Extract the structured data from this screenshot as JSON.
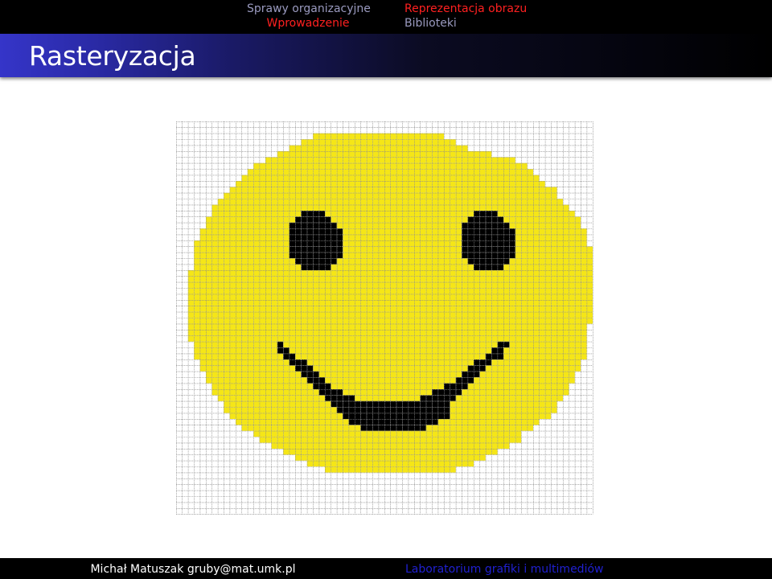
{
  "header": {
    "nav_groups": [
      {
        "items": [
          {
            "label": "Sprawy organizacyjne",
            "active": false
          },
          {
            "label": "Wprowadzenie",
            "active": true
          }
        ]
      },
      {
        "items": [
          {
            "label": "Reprezentacja obrazu",
            "active": true
          },
          {
            "label": "Biblioteki",
            "active": false
          }
        ]
      }
    ],
    "frame_title": "Rasteryzacja"
  },
  "footer": {
    "author": "Michał Matuszak",
    "email": "gruby@mat.umk.pl",
    "course": "Laboratorium grafiki i multimediów"
  },
  "colors": {
    "face": "#f5e617",
    "feature": "#000000",
    "grid_line": "#8a8a8a",
    "empty_cell": "#ffffff",
    "nav_active": "#ff2020",
    "nav_inactive": "#9a9abf",
    "course_text": "#2020d0"
  },
  "figure": {
    "grid": {
      "columns": 70,
      "rows": 66
    },
    "legend": {
      ".": "empty",
      "Y": "yellow",
      "B": "black"
    },
    "pixel_rows": [
      "......................................................................",
      "......................................................................",
      ".......................YYYYYYYYYYYYYYYYYYYYYY.........................",
      ".....................YYYYYYYYYYYYYYYYYYYYYYYYYY.......................",
      "...................YYYYYYYYYYYYYYYYYYYYYYYYYYYYYY.....................",
      ".................YYYYYYYYYYYYYYYYYYYYYYYYYYYYYYYYYYYY.................",
      "...............YYYYYYYYYYYYYYYYYYYYYYYYYYYYYYYYYYYYYYYYYY.............",
      ".............YYYYYYYYYYYYYYYYYYYYYYYYYYYYYYYYYYYYYYYYYYYYYY...........",
      "............YYYYYYYYYYYYYYYYYYYYYYYYYYYYYYYYYYYYYYYYYYYYYYYY..........",
      "...........YYYYYYYYYYYYYYYYYYYYYYYYYYYYYYYYYYYYYYYYYYYYYYYYYY.........",
      "..........YYYYYYYYYYYYYYYYYYYYYYYYYYYYYYYYYYYYYYYYYYYYYYYYYYYY........",
      ".........YYYYYYYYYYYYYYYYYYYYYYYYYYYYYYYYYYYYYYYYYYYYYYYYYYYYYYY......",
      "........YYYYYYYYYYYYYYYYYYYYYYYYYYYYYYYYYYYYYYYYYYYYYYYYYYYYYYYY......",
      ".......YYYYYYYYYYYYYYYYYYYYYYYYYYYYYYYYYYYYYYYYYYYYYYYYYYYYYYYYYY.....",
      "......YYYYYYYYYYYYYYYYYYYYYYYYYYYYYYYYYYYYYYYYYYYYYYYYYYYYYYYYYYYY....",
      "......YYYYYYYYYYYYYYYBBBBYYYYYYYYYYYYYYYYYYYYYYYYYBBBBYYYYYYYYYYYYY....",
      ".....YYYYYYYYYYYYYYYBBBBBBYYYYYYYYYYYYYYYYYYYYYYYBBBBBBYYYYYYYYYYYYY...",
      ".....YYYYYYYYYYYYYYBBBBBBBBYYYYYYYYYYYYYYYYYYYYYBBBBBBBBYYYYYYYYYYYY...",
      "....YYYYYYYYYYYYYYYBBBBBBBBBYYYYYYYYYYYYYYYYYYYYBBBBBBBBBYYYYYYYYYYYY..",
      "....YYYYYYYYYYYYYYYBBBBBBBBBYYYYYYYYYYYYYYYYYYYYBBBBBBBBBYYYYYYYYYYYY..",
      "...YYYYYYYYYYYYYYYYBBBBBBBBBYYYYYYYYYYYYYYYYYYYYBBBBBBBBBYYYYYYYYYYYY..",
      "...YYYYYYYYYYYYYYYYBBBBBBBBBYYYYYYYYYYYYYYYYYYYYBBBBBBBBBYYYYYYYYYYYYY.",
      "...YYYYYYYYYYYYYYYYBBBBBBBBBYYYYYYYYYYYYYYYYYYYYBBBBBBBBBYYYYYYYYYYYYY.",
      "...YYYYYYYYYYYYYYYYYBBBBBBBYYYYYYYYYYYYYYYYYYYYYYBBBBBBBYYYYYYYYYYYYYY.",
      "...YYYYYYYYYYYYYYYYYYBBBBBYYYYYYYYYYYYYYYYYYYYYYYYBBBBBYYYYYYYYYYYYYYY.",
      "..YYYYYYYYYYYYYYYYYYYYYYYYYYYYYYYYYYYYYYYYYYYYYYYYYYYYYYYYYYYYYYYYYYYY",
      "..YYYYYYYYYYYYYYYYYYYYYYYYYYYYYYYYYYYYYYYYYYYYYYYYYYYYYYYYYYYYYYYYYYYY",
      "..YYYYYYYYYYYYYYYYYYYYYYYYYYYYYYYYYYYYYYYYYYYYYYYYYYYYYYYYYYYYYYYYYYYY",
      "..YYYYYYYYYYYYYYYYYYYYYYYYYYYYYYYYYYYYYYYYYYYYYYYYYYYYYYYYYYYYYYYYYYYY",
      "..YYYYYYYYYYYYYYYYYYYYYYYYYYYYYYYYYYYYYYYYYYYYYYYYYYYYYYYYYYYYYYYYYYYY",
      "..YYYYYYYYYYYYYYYYYYYYYYYYYYYYYYYYYYYYYYYYYYYYYYYYYYYYYYYYYYYYYYYYYYYY",
      "..YYYYYYYYYYYYYYYYYYYYYYYYYYYYYYYYYYYYYYYYYYYYYYYYYYYYYYYYYYYYYYYYYYYY",
      "..YYYYYYYYYYYYYYYYYYYYYYYYYYYYYYYYYYYYYYYYYYYYYYYYYYYYYYYYYYYYYYYYYYYY",
      "..YYYYYYYYYYYYYYYYYYYYYYYYYYYYYYYYYYYYYYYYYYYYYYYYYYYYYYYYYYYYYYYYYYYY",
      "..YYYYYYYYYYYYYYYYYYYYYYYYYYYYYYYYYYYYYYYYYYYYYYYYYYYYYYYYYYYYYYYYYYY.",
      "..YYYYYYYYYYYYYYYYYYYYYYYYYYYYYYYYYYYYYYYYYYYYYYYYYYYYYYYYYYYYYYYYYYY.",
      "..YYYYYYYYYYYYYYYYYYYYYYYYYYYYYYYYYYYYYYYYYYYYYYYYYYYYYYYYYYYYYYYYYYY.",
      "...YYYYYYYYYYYYYYBYYYYYYYYYYYYYYYYYYYYYYYYYYYYYYYYYYYYBBYYYYYYYYYYYYY.",
      "...YYYYYYYYYYYYYYBBYYYYYYYYYYYYYYYYYYYYYYYYYYYYYYYYYYBBYYYYYYYYYYYYYY.",
      "...YYYYYYYYYYYYYYYBBYYYYYYYYYYYYYYYYYYYYYYYYYYYYYYYYBBBYYYYYYYYYYYYYY.",
      "....YYYYYYYYYYYYYYYBBBYYYYYYYYYYYYYYYYYYYYYYYYYYYYBBBYYYYYYYYYYYYYYY..",
      "....YYYYYYYYYYYYYYYYBBBYYYYYYYYYYYYYYYYYYYYYYYYYYBBBYYYYYYYYYYYYYYYY..",
      ".....YYYYYYYYYYYYYYYYBBBYYYYYYYYYYYYYYYYYYYYYYYYBBBYYYYYYYYYYYYYYYY...",
      ".....YYYYYYYYYYYYYYYYYBBBYYYYYYYYYYYYYYYYYYYYYYBBBYYYYYYYYYYYYYYYYY...",
      "......YYYYYYYYYYYYYYYYYBBBYYYYYYYYYYYYYYYYYYYBBBBYYYYYYYYYYYYYYYYY....",
      "......YYYYYYYYYYYYYYYYYYBBBBYYYYYYYYYYYYYYYBBBBBYYYYYYYYYYYYYYYYYY....",
      ".......YYYYYYYYYYYYYYYYYYBBBBBYYYYYYYYYYYBBBBBBYYYYYYYYYYYYYYYYYY.....",
      "........YYYYYYYYYYYYYYYYYYBBBBBBBBBBBBBBBBBBBBYYYYYYYYYYYYYYYYYY......",
      "........YYYYYYYYYYYYYYYYYYYBBBBBBBBBBBBBBBBBBBYYYYYYYYYYYYYYYYYY......",
      ".........YYYYYYYYYYYYYYYYYYYBBBBBBBBBBBBBBBBBBYYYYYYYYYYYYYYYYY.......",
      "..........YYYYYYYYYYYYYYYYYYYBBBBBBBBBBBBBBBYYYYYYYYYYYYYYYYY........",
      "...........YYYYYYYYYYYYYYYYYYYYBBBBBBBBBBBYYYYYYYYYYYYYYYYYY.........",
      ".............YYYYYYYYYYYYYYYYYYYYYYYYYYYYYYYYYYYYYYYYYYYYY...........",
      "..............YYYYYYYYYYYYYYYYYYYYYYYYYYYYYYYYYYYYYYYYYYYY............",
      "................YYYYYYYYYYYYYYYYYYYYYYYYYYYYYYYYYYYYYYYY..............",
      "..................YYYYYYYYYYYYYYYYYYYYYYYYYYYYYYYYYYYY................",
      "....................YYYYYYYYYYYYYYYYYYYYYYYYYYYYYYYY..................",
      "......................YYYYYYYYYYYYYYYYYYYYYYYYYYYY....................",
      ".........................YYYYYYYYYYYYYYYYYYYYYY.......................",
      "......................................................................",
      "......................................................................",
      "......................................................................",
      "......................................................................",
      "......................................................................",
      "......................................................................",
      "......................................................................"
    ]
  }
}
